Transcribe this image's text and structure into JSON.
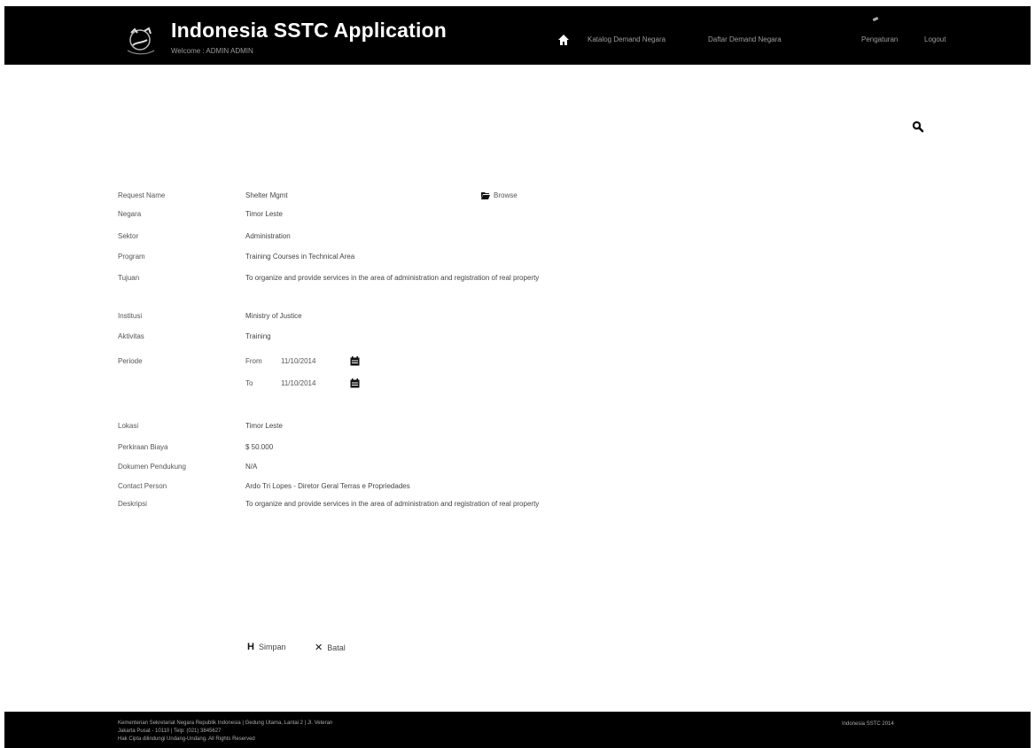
{
  "header": {
    "title": "Indonesia SSTC Application",
    "welcome": "Welcome : ADMIN ADMIN",
    "nav": {
      "home_icon": "home-icon",
      "item1": "Katalog Demand Negara",
      "item2": "Daftar Demand Negara",
      "item3": "Pengaturan",
      "item4": "Logout"
    }
  },
  "search": {
    "icon": "search-icon"
  },
  "details": {
    "request_name_label": "Request Name",
    "request_name": "Shelter Mgmt",
    "browse_label": "Browse",
    "country_label": "Negara",
    "country": "Timor Leste",
    "sector_label": "Sektor",
    "sector": "Administration",
    "program_label": "Program",
    "program": "Training Courses in Technical Area",
    "purpose_label": "Tujuan",
    "purpose": "To organize and provide services in the area of administration and registration of real property",
    "institution_label": "Institusi",
    "institution": "Ministry of Justice",
    "activity_label": "Aktivitas",
    "activity": "Training",
    "period_label": "Periode",
    "from_label": "From",
    "from_date": "11/10/2014",
    "to_label": "To",
    "to_date": "11/10/2014",
    "location_label": "Lokasi",
    "location": "Timor Leste",
    "cost_label": "Perkiraan Biaya",
    "cost": "$ 50.000",
    "funding_label": "Dokumen Pendukung",
    "funding": "N/A",
    "contact_label": "Contact Person",
    "contact": "Ardo Tri Lopes - Diretor Geral Terras e Propriedades",
    "description_label": "Deskripsi",
    "description": "To organize and provide services in the area of administration and registration of real property"
  },
  "buttons": {
    "save": "Simpan",
    "back": "Batal"
  },
  "footer": {
    "line1": "Kementerian Sekretariat Negara Republik Indonesia | Gedung Utama, Lantai 2 | Jl. Veteran",
    "line2": "Jakarta Pusat - 10110 | Telp: (021) 3845627",
    "line3": "Hak Cipta dilindungi Undang-Undang. All Rights Reserved",
    "right": "Indonesia SSTC 2014"
  },
  "colors": {
    "header_bg": "#000000",
    "footer_bg": "#000000",
    "page_bg": "#ffffff"
  }
}
